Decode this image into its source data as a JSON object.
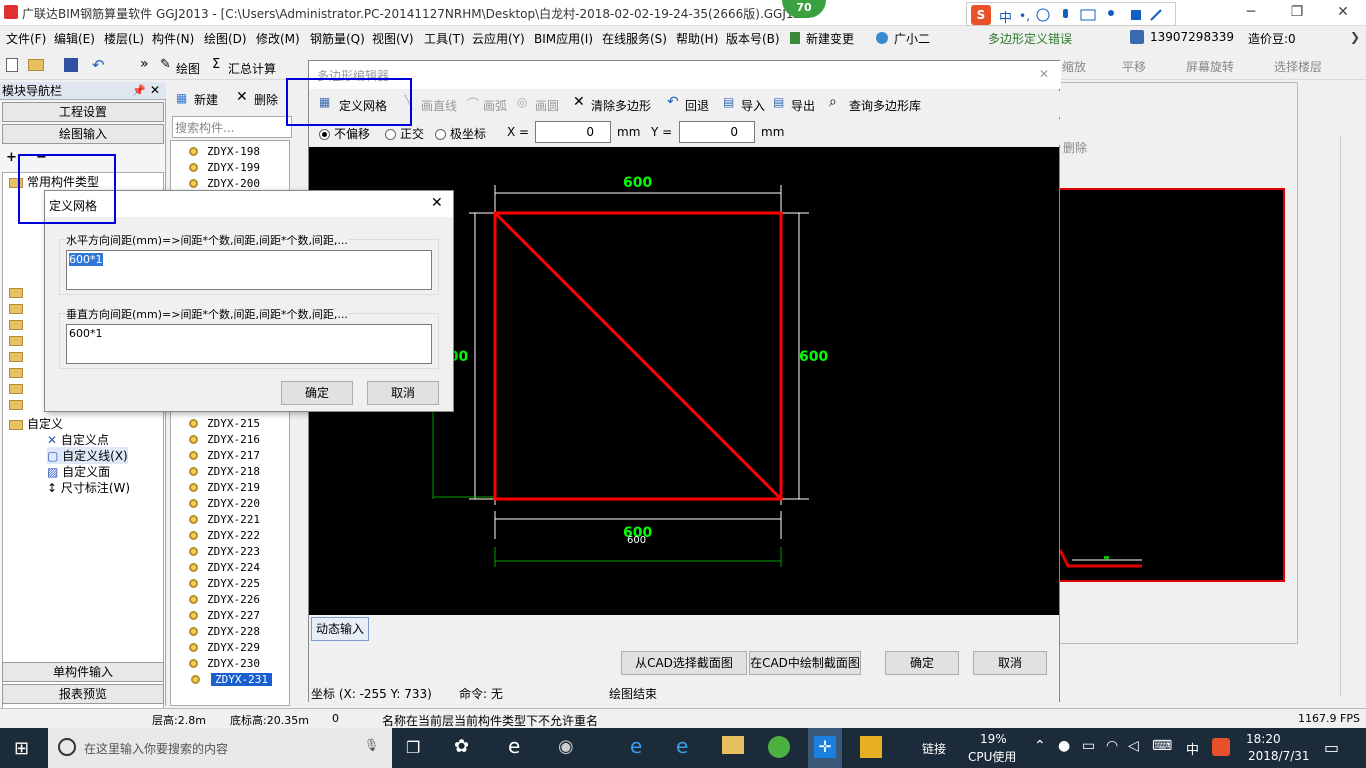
{
  "window": {
    "title": "广联达BIM钢筋算量软件 GGJ2013 - [C:\\Users\\Administrator.PC-20141127NRHM\\Desktop\\白龙村-2018-02-02-19-24-35(2666版).GGJ12",
    "badge": "70"
  },
  "ime": {
    "logo": "S",
    "lang": "中"
  },
  "menu": {
    "items": [
      "文件(F)",
      "编辑(E)",
      "楼层(L)",
      "构件(N)",
      "绘图(D)",
      "修改(M)",
      "钢筋量(Q)",
      "视图(V)",
      "工具(T)",
      "云应用(Y)",
      "BIM应用(I)",
      "在线服务(S)",
      "帮助(H)",
      "版本号(B)",
      "新建变更",
      "广小二"
    ],
    "error_notice": "多边形定义错误",
    "phone": "13907298339",
    "price_bean": "造价豆:0"
  },
  "toolbar": {
    "draw": "绘图",
    "sum": "汇总计算",
    "zoom": "缩放",
    "pan": "平移",
    "rotate": "屏幕旋转",
    "select_floor": "选择楼层"
  },
  "left_panel": {
    "title": "模块导航栏",
    "project_settings": "工程设置",
    "drawing_input": "绘图输入",
    "common_types": "常用构件类型",
    "custom": "自定义",
    "custom_point": "自定义点",
    "custom_line": "自定义线(X)",
    "custom_face": "自定义面",
    "dimension": "尺寸标注(W)",
    "single_input": "单构件输入",
    "report_preview": "报表预览"
  },
  "component_list": {
    "new": "新建",
    "delete": "删除",
    "search_placeholder": "搜索构件...",
    "top_items": [
      "ZDYX-198",
      "ZDYX-199",
      "ZDYX-200"
    ],
    "items": [
      "ZDYX-215",
      "ZDYX-216",
      "ZDYX-217",
      "ZDYX-218",
      "ZDYX-219",
      "ZDYX-220",
      "ZDYX-221",
      "ZDYX-222",
      "ZDYX-223",
      "ZDYX-224",
      "ZDYX-225",
      "ZDYX-226",
      "ZDYX-227",
      "ZDYX-228",
      "ZDYX-229",
      "ZDYX-230",
      "ZDYX-231"
    ]
  },
  "polygon_editor": {
    "title": "多边形编辑器",
    "define_grid": "定义网格",
    "draw_line": "画直线",
    "draw_arc": "画弧",
    "draw_circle": "画圆",
    "clear_polygon": "清除多边形",
    "undo": "回退",
    "import": "导入",
    "export": "导出",
    "query_library": "查询多边形库",
    "no_offset": "不偏移",
    "orthogonal": "正交",
    "polar": "极坐标",
    "x_label": "X =",
    "x_value": "0",
    "y_label": "Y =",
    "y_value": "0",
    "unit": "mm",
    "dim_top": "600",
    "dim_right": "600",
    "dim_left": "600",
    "dim_bottom": "600",
    "dim_bottom_small": "600",
    "dynamic_input": "动态输入",
    "select_from_cad": "从CAD选择截面图",
    "draw_in_cad": "在CAD中绘制截面图",
    "ok": "确定",
    "cancel": "取消",
    "coord": "坐标 (X: -255 Y: 733)",
    "command": "命令: 无",
    "status": "绘图结束"
  },
  "grid_dialog": {
    "title": "定义网格",
    "h_label": "水平方向间距(mm)=>间距*个数,间距,间距*个数,间距,...",
    "h_value": "600*1",
    "v_label": "垂直方向间距(mm)=>间距*个数,间距,间距*个数,间距,...",
    "v_value": "600*1",
    "ok": "确定",
    "cancel": "取消"
  },
  "right_area": {
    "delete": "删除"
  },
  "statusbar": {
    "floor_height": "层高:2.8m",
    "base_height": "底标高:20.35m",
    "zero": "0",
    "message": "名称在当前层当前构件类型下不允许重名",
    "fps": "1167.9 FPS"
  },
  "taskbar": {
    "search_placeholder": "在这里输入你要搜索的内容",
    "link": "链接",
    "cpu_percent": "19%",
    "cpu_label": "CPU使用",
    "lang": "中",
    "time": "18:20",
    "date": "2018/7/31"
  }
}
